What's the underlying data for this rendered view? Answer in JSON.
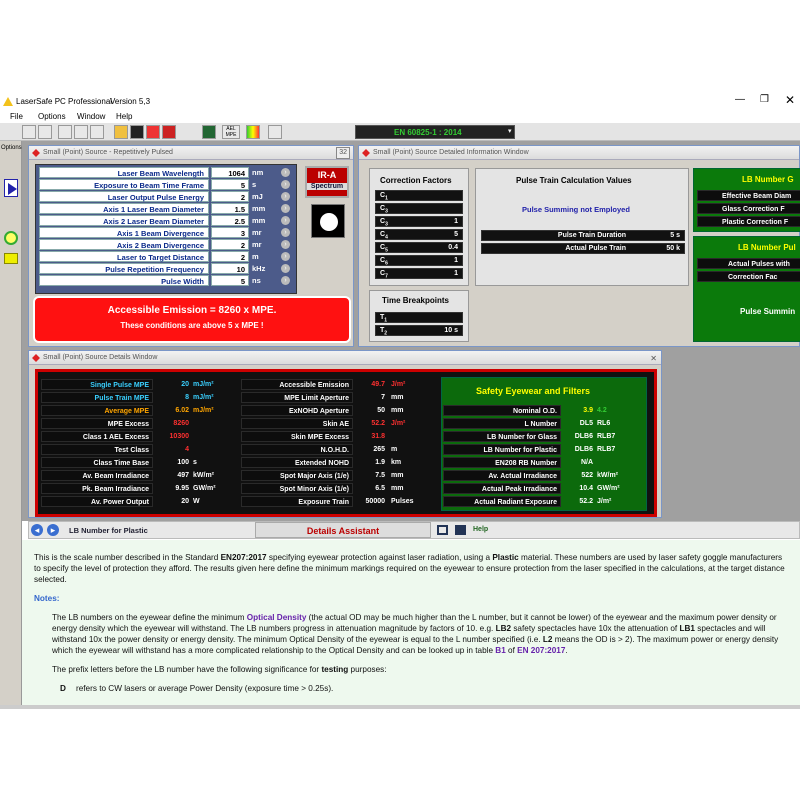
{
  "app": {
    "title": "LaserSafe PC Professional",
    "version": "Version 5,3"
  },
  "menu": [
    "File",
    "Options",
    "Window",
    "Help"
  ],
  "standard": "EN 60825-1 : 2014",
  "options_tab": "Options",
  "w1": {
    "title": "Small (Point) Source - Repetitively Pulsed",
    "close": "32",
    "params": [
      {
        "label": "Laser Beam Wavelength",
        "value": "1064",
        "unit": "nm"
      },
      {
        "label": "Exposure to Beam Time Frame",
        "value": "5",
        "unit": "s"
      },
      {
        "label": "Laser Output Pulse Energy",
        "value": "2",
        "unit": "mJ"
      },
      {
        "label": "Axis 1 Laser Beam Diameter",
        "value": "1.5",
        "unit": "mm"
      },
      {
        "label": "Axis 2 Laser Beam Diameter",
        "value": "2.5",
        "unit": "mm"
      },
      {
        "label": "Axis 1 Beam Divergence",
        "value": "3",
        "unit": "mr"
      },
      {
        "label": "Axis 2 Beam Divergence",
        "value": "2",
        "unit": "mr"
      },
      {
        "label": "Laser to Target Distance",
        "value": "2",
        "unit": "m"
      },
      {
        "label": "Pulse Repetition Frequency",
        "value": "10",
        "unit": "kHz"
      },
      {
        "label": "Pulse Width",
        "value": "5",
        "unit": "ns"
      }
    ],
    "band": "IR-A",
    "spectrum": "Spectrum",
    "ae_title": "Accessible Emission = 8260 x MPE.",
    "ae_sub": "These conditions are above 5 x MPE !"
  },
  "w2": {
    "title": "Small (Point) Source Detailed Information Window",
    "cf_title": "Correction Factors",
    "cf": [
      {
        "k": "C",
        "s": "1",
        "v": ""
      },
      {
        "k": "C",
        "s": "3",
        "v": ""
      },
      {
        "k": "C",
        "s": "3",
        "v": "1"
      },
      {
        "k": "C",
        "s": "4",
        "v": "5"
      },
      {
        "k": "C",
        "s": "5",
        "v": "0.4"
      },
      {
        "k": "C",
        "s": "6",
        "v": "1"
      },
      {
        "k": "C",
        "s": "7",
        "v": "1"
      }
    ],
    "tb_title": "Time Breakpoints",
    "tb": [
      {
        "k": "T",
        "s": "1",
        "v": ""
      },
      {
        "k": "T",
        "s": "2",
        "v": "10 s"
      }
    ],
    "pt_title": "Pulse Train Calculation Values",
    "pt_status": "Pulse Summing not Employed",
    "pt": [
      {
        "label": "Pulse Train Duration",
        "value": "5 s"
      },
      {
        "label": "Actual Pulse Train",
        "value": "50 k"
      }
    ],
    "lb_title": "LB Number G",
    "lb_rows": [
      "Effective Beam Diam",
      "Glass Correction F",
      "Plastic Correction F"
    ],
    "lbp_title": "LB Number Pul",
    "lbp_rows": [
      "Actual Pulses with",
      "Correction Fac"
    ],
    "ps": "Pulse Summin"
  },
  "w3": {
    "title": "Small (Point) Source Details Window",
    "col1": [
      {
        "label": "Single Pulse MPE",
        "value": "20",
        "unit": "mJ/m²",
        "lc": "cyan",
        "vc": "cyan"
      },
      {
        "label": "Pulse Train MPE",
        "value": "8",
        "unit": "mJ/m²",
        "lc": "cyan",
        "vc": "cyan"
      },
      {
        "label": "Average MPE",
        "value": "6.02",
        "unit": "mJ/m²",
        "lc": "orange",
        "vc": "orange"
      },
      {
        "label": "MPE Excess",
        "value": "8260",
        "unit": "",
        "lc": "white",
        "vc": "red"
      },
      {
        "label": "Class 1 AEL Excess",
        "value": "10300",
        "unit": "",
        "lc": "white",
        "vc": "red"
      },
      {
        "label": "Test Class",
        "value": "4",
        "unit": "",
        "lc": "white",
        "vc": "red"
      },
      {
        "label": "Class Time Base",
        "value": "100",
        "unit": "s",
        "lc": "white",
        "vc": "white"
      },
      {
        "label": "Av. Beam Irradiance",
        "value": "497",
        "unit": "kW/m²",
        "lc": "white",
        "vc": "white"
      },
      {
        "label": "Pk. Beam Irradiance",
        "value": "9.95",
        "unit": "GW/m²",
        "lc": "white",
        "vc": "white"
      },
      {
        "label": "Av. Power Output",
        "value": "20",
        "unit": "W",
        "lc": "white",
        "vc": "white"
      }
    ],
    "col2": [
      {
        "label": "Accessible Emission",
        "value": "49.7",
        "unit": "J/m²",
        "vc": "red"
      },
      {
        "label": "MPE Limit Aperture",
        "value": "7",
        "unit": "mm",
        "vc": "white"
      },
      {
        "label": "ExNOHD Aperture",
        "value": "50",
        "unit": "mm",
        "vc": "white"
      },
      {
        "label": "Skin AE",
        "value": "52.2",
        "unit": "J/m²",
        "vc": "red"
      },
      {
        "label": "Skin MPE Excess",
        "value": "31.8",
        "unit": "",
        "vc": "red"
      },
      {
        "label": "N.O.H.D.",
        "value": "265",
        "unit": "m",
        "vc": "white"
      },
      {
        "label": "Extended NOHD",
        "value": "1.9",
        "unit": "km",
        "vc": "white"
      },
      {
        "label": "Spot Major Axis (1/e)",
        "value": "7.5",
        "unit": "mm",
        "vc": "white"
      },
      {
        "label": "Spot Minor Axis (1/e)",
        "value": "6.5",
        "unit": "mm",
        "vc": "white"
      },
      {
        "label": "Exposure Train",
        "value": "50000",
        "unit": "Pulses",
        "vc": "white"
      }
    ],
    "eyewear_title": "Safety Eyewear and Filters",
    "eyewear": [
      {
        "label": "Nominal O.D.",
        "v1": "3.9",
        "v2": "4.2"
      },
      {
        "label": "L Number",
        "v1": "DL5",
        "v2": "RL6"
      },
      {
        "label": "LB Number for Glass",
        "v1": "DLB6",
        "v2": "RLB7"
      },
      {
        "label": "LB Number for Plastic",
        "v1": "DLB6",
        "v2": "RLB7"
      },
      {
        "label": "EN208 RB Number",
        "v1": "N/A",
        "v2": ""
      },
      {
        "label": "Av. Actual Irradiance",
        "v1": "522",
        "v2": "kW/m²"
      },
      {
        "label": "Actual Peak Irradiance",
        "v1": "10.4",
        "v2": "GW/m²"
      },
      {
        "label": "Actual Radiant Exposure",
        "v1": "52.2",
        "v2": "J/m²"
      }
    ]
  },
  "assistant": {
    "topic": "LB Number for Plastic",
    "title": "Details Assistant",
    "help": "Help"
  },
  "help": {
    "p1a": "This is the scale number described in the Standard ",
    "p1b": "EN207:2017",
    "p1c": " specifying eyewear protection against laser radiation, using a ",
    "p1d": "Plastic",
    "p1e": " material.  These numbers are used by laser safety goggle manufacturers to specify the level of protection they afford.  The results given here define the minimum markings required on the eyewear to ensure protection from the laser specified in the calculations, at the target distance selected.",
    "notes": "Notes:",
    "n1a": "The LB numbers on the eyewear define the minimum ",
    "n1b": "Optical Density",
    "n1c": " (the actual OD may be much higher than the L number, but it cannot be lower) of the eyewear and the maximum power density or energy density which the eyewear will withstand.  The LB numbers progress in attenuation magnitude by factors of 10. e.g. ",
    "n1d": "LB2",
    "n1e": " safety spectacles have 10x the attenuation of ",
    "n1f": "LB1",
    "n1g": " spectacles and will withstand 10x the power density or energy density.  The minimum Optical Density of the eyewear is equal to the L number specified (i.e. ",
    "n1h": "L2",
    "n1i": " means the OD is > 2).  The maximum power or energy density which the eyewear will withstand has a more complicated relationship to the Optical Density and can be looked up in table ",
    "n1j": "B1",
    "n1k": " of ",
    "n1l": "EN 207:2017",
    "n2a": "The prefix letters before the LB number have the following significance for ",
    "n2b": "testing",
    "n2c": " purposes:",
    "dkey": "D",
    "dtext": "refers to CW lasers or average Power Density (exposure time > 0.25s)."
  }
}
